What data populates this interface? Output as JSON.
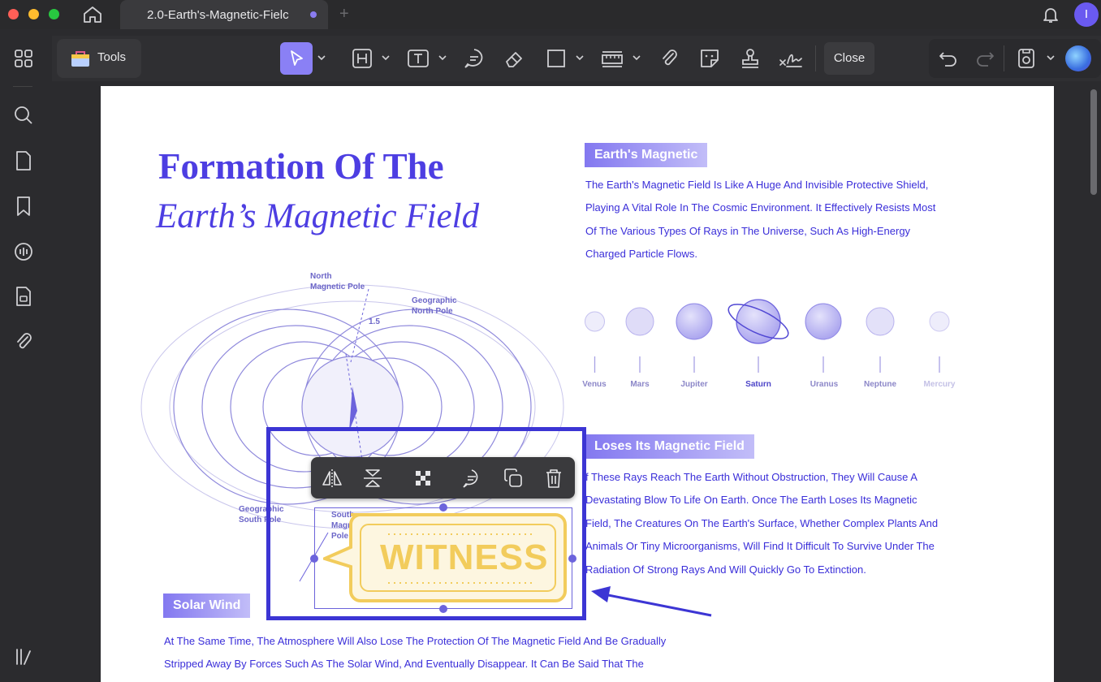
{
  "app": {
    "tab_title": "2.0-Earth's-Magnetic-Fielc",
    "tab_plus": "+",
    "avatar_initial": "I"
  },
  "sidebar": {
    "items": [
      "thumbnails-icon",
      "search-icon",
      "pages-icon",
      "bookmark-icon",
      "ai-chat-icon",
      "organize-icon",
      "attachment-icon",
      "sidebar-toggle-icon"
    ]
  },
  "toolbar": {
    "tools_label": "Tools",
    "close_label": "Close"
  },
  "document": {
    "title_line1": "Formation Of The",
    "title_line2": "Earth’s Magnetic Field",
    "section1": {
      "heading": "Earth's Magnetic",
      "lines": [
        "The Earth's Magnetic Field Is Like A Huge And Invisible Protective Shield,",
        "Playing A Vital Role In The Cosmic Environment. It Effectively Resists Most",
        "Of The Various Types Of Rays in The Universe, Such As High-Energy",
        "Charged Particle Flows."
      ]
    },
    "planets": [
      {
        "name": "Venus"
      },
      {
        "name": "Mars"
      },
      {
        "name": "Jupiter"
      },
      {
        "name": "Saturn"
      },
      {
        "name": "Uranus"
      },
      {
        "name": "Neptune"
      },
      {
        "name": "Mercury"
      }
    ],
    "section2": {
      "heading": "Loses Its Magnetic Field",
      "lines": [
        "f These Rays Reach The Earth Without Obstruction, They Will Cause A",
        "Devastating Blow To Life On Earth. Once The Earth Loses Its Magnetic",
        "Field, The Creatures On The Earth's Surface, Whether Complex Plants And",
        "Animals Or Tiny Microorganisms, Will Find It Difficult To Survive Under The",
        "Radiation Of Strong Rays And Will Quickly Go To Extinction."
      ]
    },
    "section3": {
      "heading": "Solar Wind",
      "lines": [
        "At The Same Time, The Atmosphere Will Also Lose The Protection Of The Magnetic Field And Be Gradually",
        "Stripped Away By Forces Such As The Solar Wind, And Eventually Disappear. It Can Be Said That The"
      ]
    },
    "diagram_labels": {
      "north_magnetic": "North\nMagnetic Pole",
      "geo_north": "Geographic\nNorth Pole",
      "angle": "1.5",
      "geo_south": "Geographic\nSouth Pole",
      "south_magnetic": "South\nMagnetic\nPole"
    },
    "stamp": {
      "text": "WITNESS"
    }
  },
  "colors": {
    "accent": "#8a80f5",
    "selection": "#3c35d4",
    "stamp": "#f2cc5c",
    "text_blue": "#3a2ed9"
  }
}
